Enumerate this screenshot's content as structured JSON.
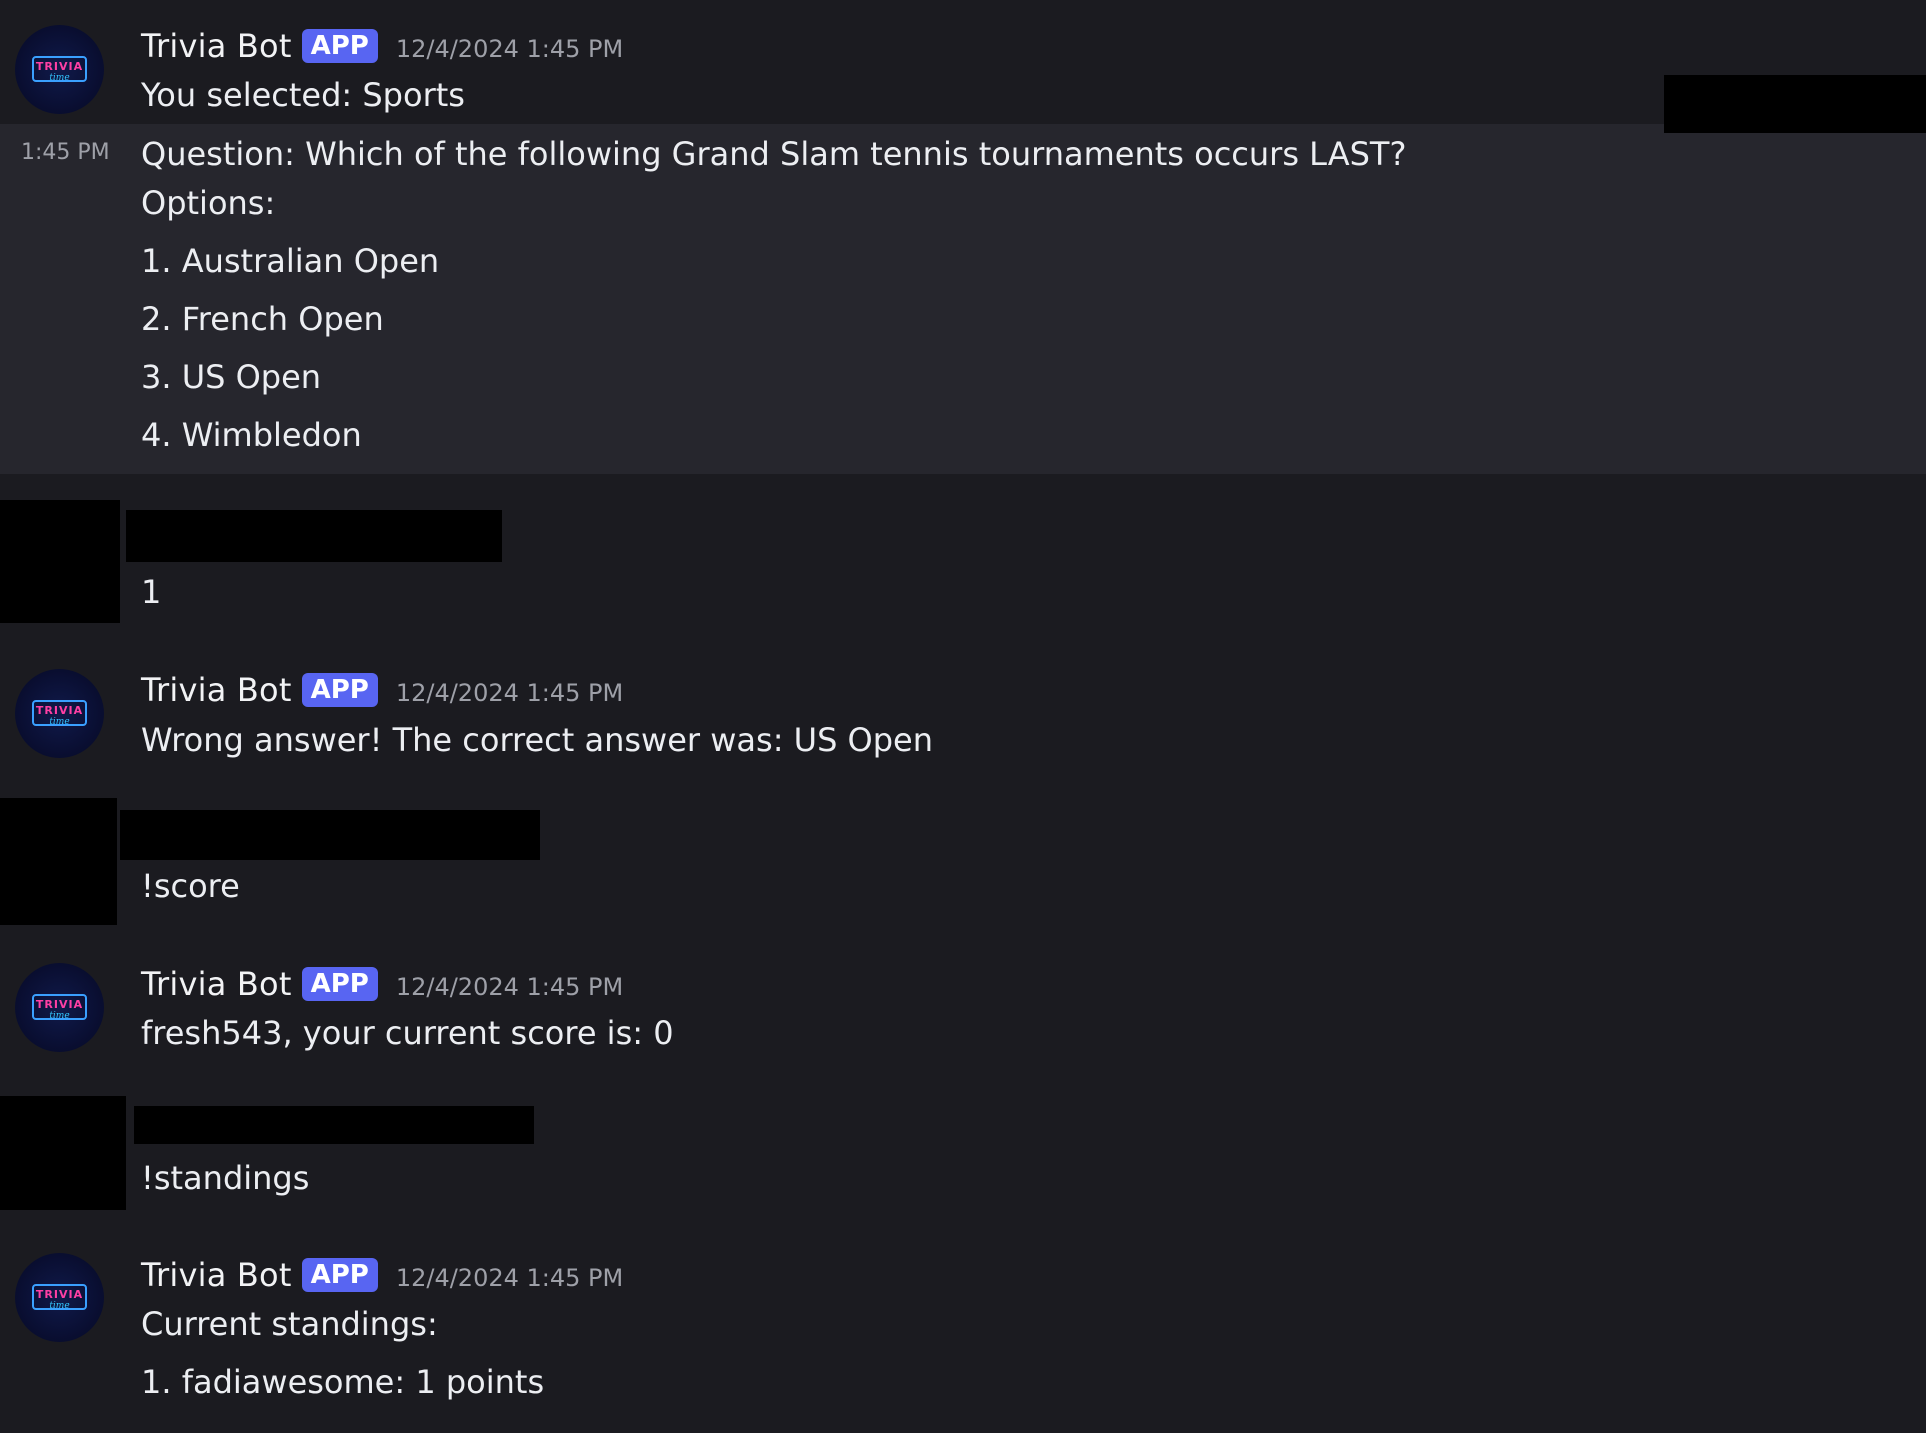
{
  "bot": {
    "name": "Trivia Bot",
    "badge": "APP",
    "avatar_text_top": "TRIVIA",
    "avatar_text_bottom": "time"
  },
  "messages": [
    {
      "timestamp": "12/4/2024 1:45 PM",
      "lines": [
        "You selected: Sports"
      ]
    },
    {
      "side_time": "1:45 PM",
      "lines": [
        "Question: Which of the following Grand Slam tennis tournaments occurs LAST?",
        "Options:",
        "1. Australian Open",
        "2. French Open",
        "3. US Open",
        "4. Wimbledon"
      ]
    },
    {
      "lines": [
        "1"
      ]
    },
    {
      "timestamp": "12/4/2024 1:45 PM",
      "lines": [
        "Wrong answer! The correct answer was: US Open"
      ]
    },
    {
      "lines": [
        "!score"
      ]
    },
    {
      "timestamp": "12/4/2024 1:45 PM",
      "lines": [
        "fresh543, your current score is: 0"
      ]
    },
    {
      "lines": [
        "!standings"
      ]
    },
    {
      "timestamp": "12/4/2024 1:45 PM",
      "lines": [
        "Current standings:",
        "1. fadiawesome: 1 points"
      ]
    }
  ],
  "colors": {
    "background": "#1b1b20",
    "hover_background": "#26262d",
    "badge": "#5865f2",
    "timestamp": "#9ea0a8",
    "text": "#eceef2"
  }
}
